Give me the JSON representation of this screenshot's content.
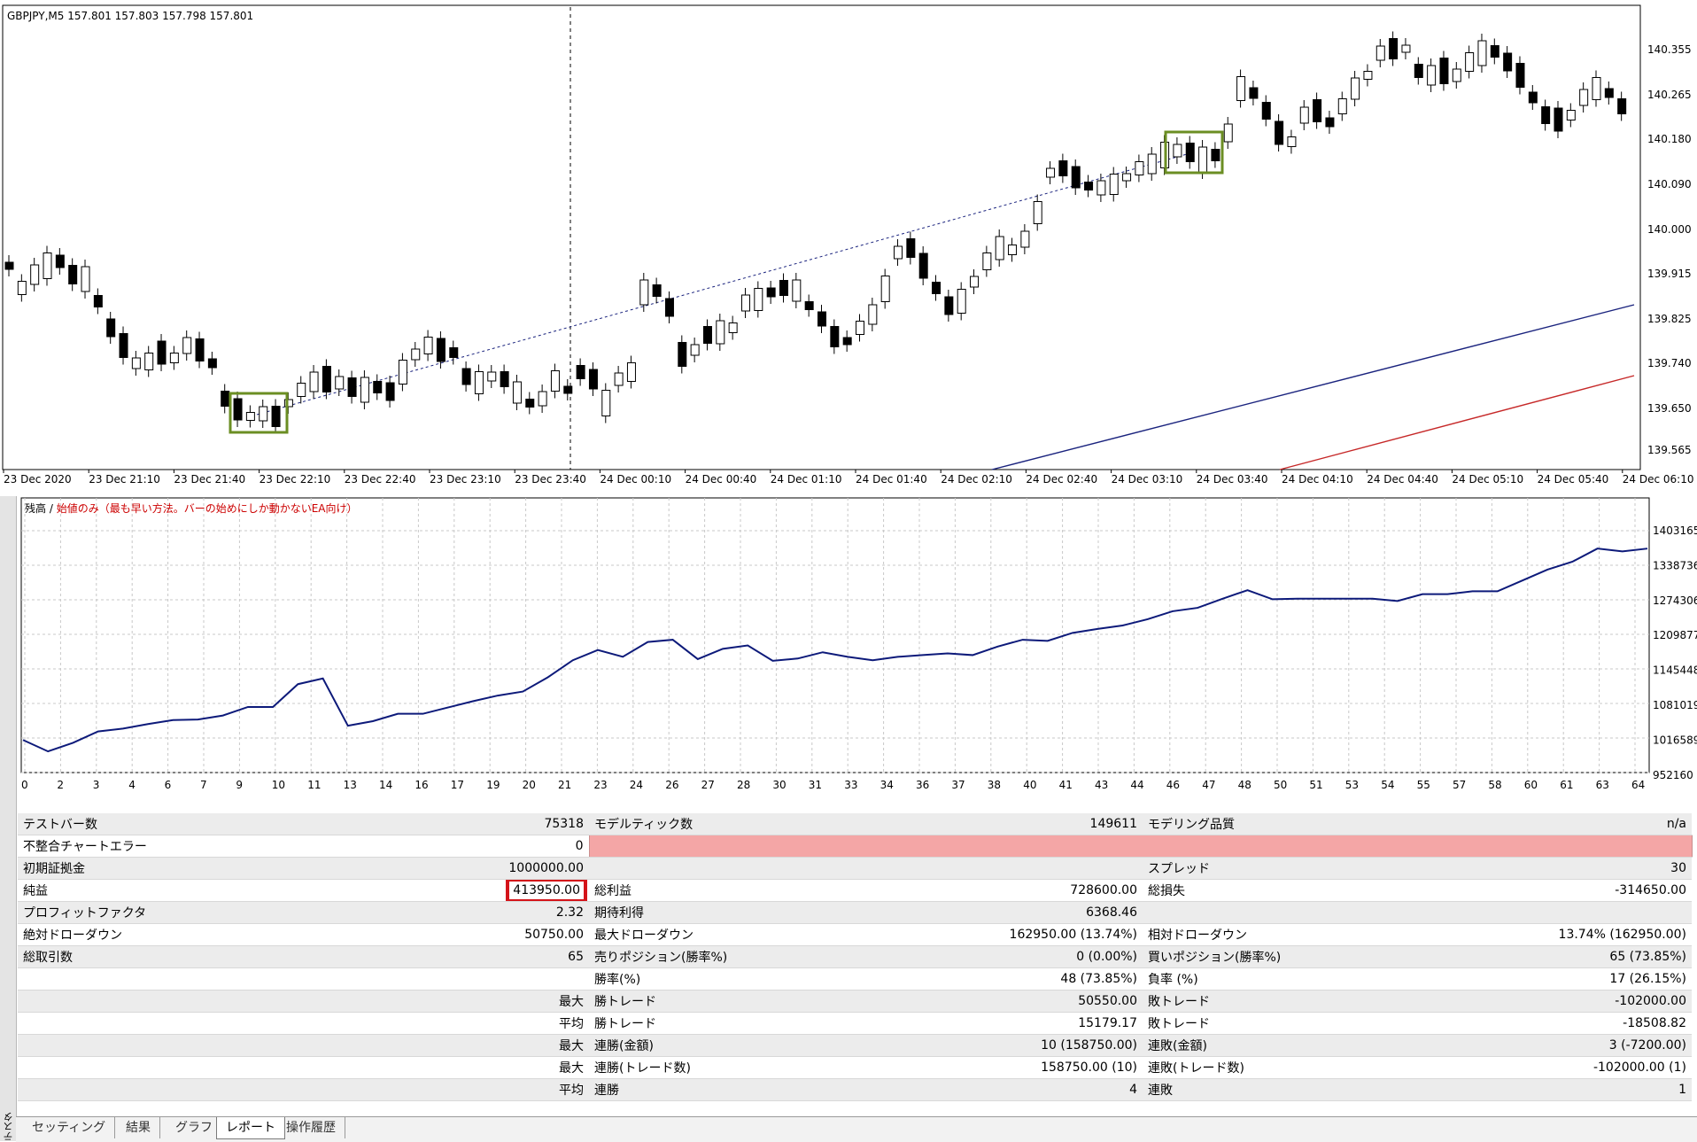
{
  "price_chart": {
    "header": "GBPJPY,M5  157.801 157.803 157.798 157.801",
    "price_labels": [
      "140.355",
      "140.265",
      "140.180",
      "140.090",
      "140.000",
      "139.915",
      "139.825",
      "139.740",
      "139.650",
      "139.565"
    ],
    "time_labels": [
      "23 Dec 2020",
      "23 Dec 21:10",
      "23 Dec 21:40",
      "23 Dec 22:10",
      "23 Dec 22:40",
      "23 Dec 23:10",
      "23 Dec 23:40",
      "24 Dec 00:10",
      "24 Dec 00:40",
      "24 Dec 01:10",
      "24 Dec 01:40",
      "24 Dec 02:10",
      "24 Dec 02:40",
      "24 Dec 03:10",
      "24 Dec 03:40",
      "24 Dec 04:10",
      "24 Dec 04:40",
      "24 Dec 05:10",
      "24 Dec 05:40",
      "24 Dec 06:10"
    ],
    "colors": {
      "ma_blue": "#1a237e",
      "ma_red": "#c62828",
      "box": "#6b8e23",
      "bull": "#ffffff",
      "bear": "#000000"
    }
  },
  "equity_chart": {
    "title_prefix": "残高 / ",
    "title_note": "始値のみ（最も早い方法。バーの始めにしか動かないEA向け）",
    "colors": {
      "line": "#0d1a7a",
      "note": "#cc0000",
      "grid": "#c8c8c8"
    }
  },
  "chart_data": {
    "type": "line",
    "x_tick_labels": [
      "0",
      "2",
      "3",
      "4",
      "6",
      "7",
      "9",
      "10",
      "11",
      "13",
      "14",
      "16",
      "17",
      "19",
      "20",
      "21",
      "23",
      "24",
      "26",
      "27",
      "28",
      "30",
      "31",
      "33",
      "34",
      "36",
      "37",
      "38",
      "40",
      "41",
      "43",
      "44",
      "46",
      "47",
      "48",
      "50",
      "51",
      "53",
      "54",
      "55",
      "57",
      "58",
      "60",
      "61",
      "63",
      "64"
    ],
    "y_tick_labels": [
      "1403165",
      "1338736",
      "1274306",
      "1209877",
      "1145448",
      "1081019",
      "1016589",
      "952160"
    ],
    "ylim": [
      952160,
      1403165
    ],
    "series": [
      {
        "values": [
          1000000,
          980000,
          995000,
          1015000,
          1020000,
          1028000,
          1035000,
          1036000,
          1043000,
          1058000,
          1058000,
          1098000,
          1108000,
          1025000,
          1033000,
          1046000,
          1046000,
          1057000,
          1068000,
          1078000,
          1085000,
          1110000,
          1140000,
          1158000,
          1146000,
          1172000,
          1176000,
          1142000,
          1160000,
          1166000,
          1139000,
          1143000,
          1154000,
          1146000,
          1140000,
          1146000,
          1149000,
          1152000,
          1149000,
          1164000,
          1176000,
          1174000,
          1188000,
          1195000,
          1201000,
          1212000,
          1226000,
          1232000,
          1248000,
          1263000,
          1247000,
          1248000,
          1248000,
          1248000,
          1248000,
          1244000,
          1256000,
          1256000,
          1261000,
          1261000,
          1280000,
          1299000,
          1313000,
          1336000,
          1331000,
          1336000
        ]
      }
    ]
  },
  "report": {
    "rows": [
      [
        "テストバー数",
        "75318",
        "モデルティック数",
        "149611",
        "モデリング品質",
        "n/a"
      ],
      [
        "不整合チャートエラー",
        "0",
        "",
        "",
        "",
        ""
      ],
      [
        "初期証拠金",
        "1000000.00",
        "",
        "",
        "スプレッド",
        "30"
      ],
      [
        "純益",
        "413950.00",
        "総利益",
        "728600.00",
        "総損失",
        "-314650.00"
      ],
      [
        "プロフィットファクタ",
        "2.32",
        "期待利得",
        "6368.46",
        "",
        ""
      ],
      [
        "絶対ドローダウン",
        "50750.00",
        "最大ドローダウン",
        "162950.00 (13.74%)",
        "相対ドローダウン",
        "13.74% (162950.00)"
      ],
      [
        "総取引数",
        "65",
        "売りポジション(勝率%)",
        "0 (0.00%)",
        "買いポジション(勝率%)",
        "65 (73.85%)"
      ],
      [
        "",
        "",
        "勝率(%)",
        "48 (73.85%)",
        "負率 (%)",
        "17 (26.15%)"
      ],
      [
        "",
        "最大",
        "勝トレード",
        "50550.00",
        "敗トレード",
        "-102000.00"
      ],
      [
        "",
        "平均",
        "勝トレード",
        "15179.17",
        "敗トレード",
        "-18508.82"
      ],
      [
        "",
        "最大",
        "連勝(金額)",
        "10 (158750.00)",
        "連敗(金額)",
        "3 (-7200.00)"
      ],
      [
        "",
        "最大",
        "連勝(トレード数)",
        "158750.00 (10)",
        "連敗(トレード数)",
        "-102000.00 (1)"
      ],
      [
        "",
        "平均",
        "連勝",
        "4",
        "連敗",
        "1"
      ]
    ]
  },
  "tabs": [
    "セッティング",
    "結果",
    "グラフ",
    "レポート",
    "操作履歴"
  ],
  "side_label": "テスター",
  "close_glyph": "×"
}
